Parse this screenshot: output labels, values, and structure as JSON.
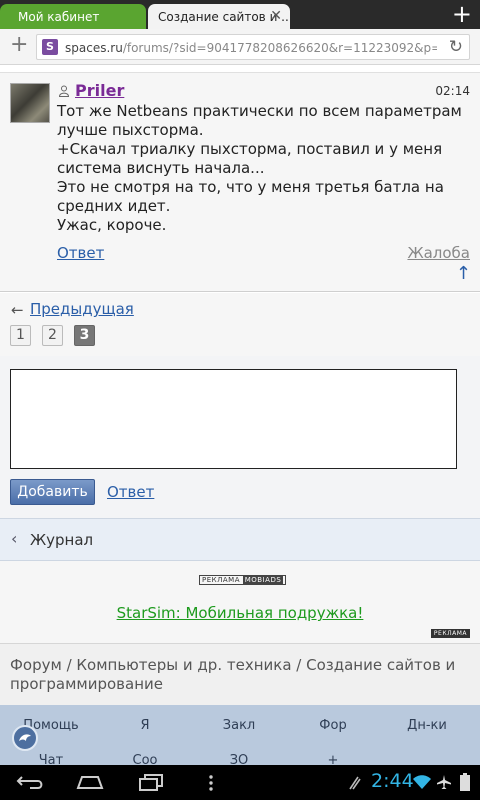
{
  "browser": {
    "tabs": [
      {
        "label": "Мой кабинет"
      },
      {
        "label": "Создание сайтов и ..."
      }
    ],
    "url_host": "spaces.ru",
    "url_path": "/forums/?sid=9041778208626620&r=11223092&p=3&fro...",
    "site_icon_letter": "S"
  },
  "post": {
    "author": "Priler",
    "time": "02:14",
    "lines": [
      "Тот же Netbeans практически по всем параметрам",
      "лучше пыхсторма.",
      "+Скачал триалку пыхсторма, поставил и у меня",
      "система виснуть начала...",
      "Это не смотря на то, что у меня третья батла на",
      "средних идет.",
      "Ужас, короче."
    ],
    "reply_label": "Ответ",
    "report_label": "Жалоба"
  },
  "pager": {
    "prev_label": "Предыдущая",
    "pages": [
      "1",
      "2",
      "3"
    ],
    "current": "3"
  },
  "form": {
    "submit_label": "Добавить",
    "reply_label": "Ответ"
  },
  "journal": {
    "label": "Журнал"
  },
  "ad": {
    "badge_left": "РЕКЛАМА",
    "badge_right": "MOBIADS",
    "link_text": "StarSim: Мобильная подружка!",
    "badge2": "РЕКЛАМА"
  },
  "breadcrumb": "Форум / Компьютеры и др. техника / Создание сайтов и программирование",
  "bottom_nav": {
    "row1": [
      "Помощь",
      "Я",
      "Закл",
      "Фор",
      "Дн-ки"
    ],
    "row2": [
      "Чат",
      "Соо",
      "ЗО",
      "+"
    ]
  },
  "system": {
    "clock": "2:44"
  },
  "colors": {
    "accent_link": "#2a5ea8",
    "ad_green": "#1d9a1d",
    "clock": "#33b5e5",
    "tab_green": "#5aa530"
  }
}
